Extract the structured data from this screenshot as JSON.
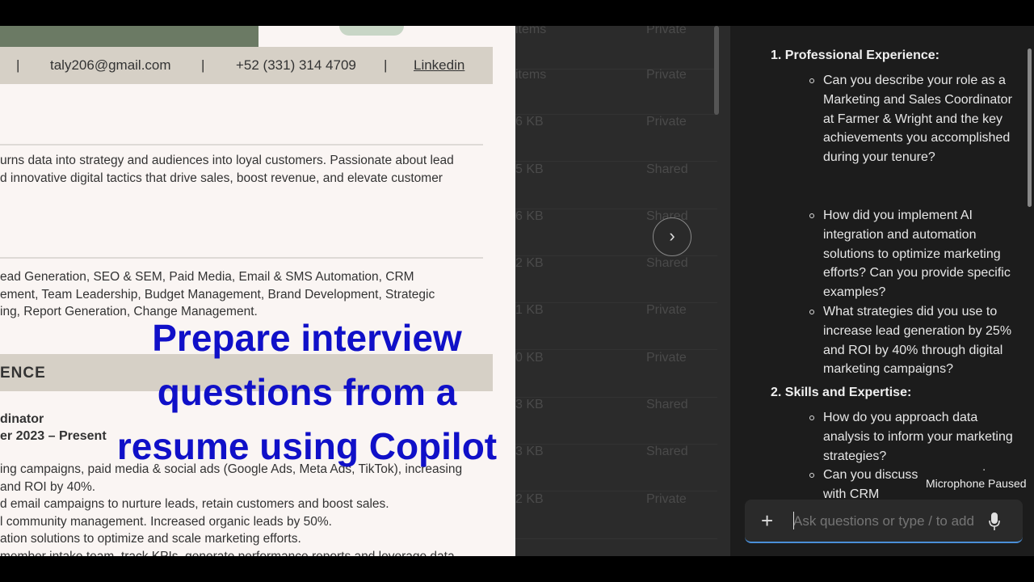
{
  "resume": {
    "contact": {
      "separator": "|",
      "email": "taly206@gmail.com",
      "phone": "+52 (331) 314 4709",
      "link": "Linkedin"
    },
    "summary": [
      "urns data into strategy and audiences into loyal customers. Passionate about lead",
      "d innovative digital tactics that drive sales, boost revenue, and elevate customer"
    ],
    "skills": [
      "ead Generation, SEO & SEM, Paid Media, Email & SMS Automation, CRM",
      "ement, Team Leadership, Budget Management, Brand Development, Strategic",
      "ing, Report Generation, Change Management."
    ],
    "experience_heading": "ENCE",
    "job_title": "dinator",
    "job_dates": "er 2023 – Present",
    "bullets": [
      "ing campaigns, paid media & social ads (Google Ads, Meta Ads, TikTok), increasing",
      "and ROI by 40%.",
      "d email campaigns to nurture leads, retain customers and boost sales.",
      "l community management. Increased organic leads by 50%.",
      "ation solutions to optimize and scale marketing efforts.",
      "member intake team, track KPIs, generate performance reports and leverage data"
    ]
  },
  "overlay": {
    "line1": "Prepare interview",
    "line2": "questions from a",
    "line3": "resume using Copilot"
  },
  "files": {
    "rows": [
      {
        "size": "items",
        "share": "Private"
      },
      {
        "size": "items",
        "share": "Private"
      },
      {
        "size": "6 KB",
        "share": "Private"
      },
      {
        "size": "5 KB",
        "share": "Shared"
      },
      {
        "size": "6 KB",
        "share": "Shared"
      },
      {
        "size": "2 KB",
        "share": "Shared"
      },
      {
        "size": "1 KB",
        "share": "Private"
      },
      {
        "size": "0 KB",
        "share": "Private"
      },
      {
        "size": "3 KB",
        "share": "Shared"
      },
      {
        "size": "3 KB",
        "share": "Shared"
      },
      {
        "size": "2 KB",
        "share": "Private"
      }
    ],
    "next_icon": "chevron-right-icon"
  },
  "copilot": {
    "sections": [
      {
        "title": "1. Professional Experience:",
        "questions": [
          "Can you describe your role as a Marketing and Sales Coordinator at Farmer & Wright and the key achievements you accomplished during your tenure?",
          "How did you implement AI integration and automation solutions to optimize marketing efforts? Can you provide specific examples?",
          "What strategies did you use to increase lead generation by 25% and ROI by 40% through digital marketing campaigns?"
        ]
      },
      {
        "title": "2. Skills and Expertise:",
        "questions": [
          "How do you approach data analysis to inform your marketing strategies?",
          "Can you discuss your experience with CRM"
        ]
      }
    ],
    "tooltip": "Microphone Paused",
    "input_placeholder": "Ask questions or type / to add"
  }
}
